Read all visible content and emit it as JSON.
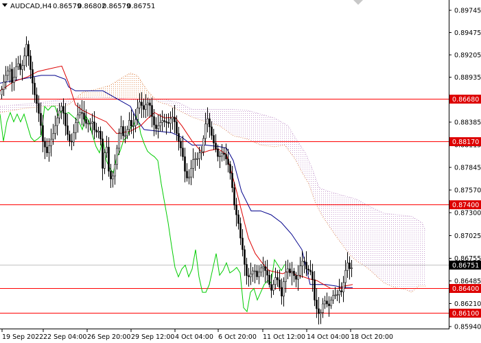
{
  "header": {
    "symbol": "AUDCAD,H4",
    "open": "0.86579",
    "high": "0.86802",
    "low": "0.86579",
    "close": "0.86751"
  },
  "colors": {
    "level_line": "#ff0000",
    "level_box": "#dd0000",
    "tenkan": "#dd0000",
    "kijun": "#00008b",
    "chikou": "#00cc00",
    "span_a_cloud": "#e0905a",
    "span_b_cloud": "#c8a0d0",
    "candle": "#000000",
    "current_price_line": "#c0c0c0",
    "current_price_box": "#000000"
  },
  "chart_data": {
    "type": "candlestick",
    "title": "AUDCAD,H4",
    "indicators": [
      "Ichimoku Kinko Hyo"
    ],
    "ylim": [
      0.8594,
      0.9004
    ],
    "y_ticks": [
      "0.89745",
      "0.89475",
      "0.89205",
      "0.88935",
      "0.88655",
      "0.88385",
      "0.88115",
      "0.87845",
      "0.87570",
      "0.87300",
      "0.87025",
      "0.86755",
      "0.86485",
      "0.86210",
      "0.85940"
    ],
    "x_ticks": [
      "19 Sep 2022",
      "22 Sep 04:00",
      "26 Sep 20:00",
      "29 Sep 12:00",
      "4 Oct 04:00",
      "6 Oct 20:00",
      "11 Oct 12:00",
      "14 Oct 04:00",
      "18 Oct 20:00"
    ],
    "levels": [
      {
        "label": "0.86680",
        "value": 0.8868
      },
      {
        "label": "0.88170",
        "value": 0.8817
      },
      {
        "label": "0.87400",
        "value": 0.874
      },
      {
        "label": "0.86400",
        "value": 0.864
      },
      {
        "label": "0.86100",
        "value": 0.861
      }
    ],
    "current_price": {
      "label": "0.86751",
      "value": 0.86751
    },
    "price_path": [
      [
        0,
        0.8895
      ],
      [
        6,
        0.8915
      ],
      [
        10,
        0.8925
      ],
      [
        14,
        0.8928
      ],
      [
        18,
        0.8905
      ],
      [
        22,
        0.893
      ],
      [
        26,
        0.8935
      ],
      [
        30,
        0.8925
      ],
      [
        34,
        0.894
      ],
      [
        38,
        0.896
      ],
      [
        42,
        0.894
      ],
      [
        46,
        0.8915
      ],
      [
        50,
        0.8895
      ],
      [
        54,
        0.888
      ],
      [
        58,
        0.8862
      ],
      [
        62,
        0.8835
      ],
      [
        68,
        0.882
      ],
      [
        73,
        0.8835
      ],
      [
        77,
        0.8845
      ],
      [
        82,
        0.8862
      ],
      [
        86,
        0.8874
      ],
      [
        90,
        0.8882
      ],
      [
        95,
        0.8855
      ],
      [
        99,
        0.884
      ],
      [
        103,
        0.883
      ],
      [
        108,
        0.885
      ],
      [
        112,
        0.8868
      ],
      [
        118,
        0.8874
      ],
      [
        124,
        0.8858
      ],
      [
        130,
        0.8858
      ],
      [
        134,
        0.886
      ],
      [
        138,
        0.8846
      ],
      [
        143,
        0.8848
      ],
      [
        146,
        0.8838
      ],
      [
        149,
        0.88
      ],
      [
        152,
        0.882
      ],
      [
        154,
        0.884
      ],
      [
        157,
        0.8802
      ],
      [
        160,
        0.8785
      ],
      [
        164,
        0.879
      ],
      [
        168,
        0.881
      ],
      [
        172,
        0.8842
      ],
      [
        176,
        0.8854
      ],
      [
        180,
        0.8838
      ],
      [
        184,
        0.8846
      ],
      [
        188,
        0.8862
      ],
      [
        192,
        0.8852
      ],
      [
        196,
        0.8858
      ],
      [
        200,
        0.8878
      ],
      [
        204,
        0.8888
      ],
      [
        208,
        0.8874
      ],
      [
        212,
        0.8882
      ],
      [
        217,
        0.8886
      ],
      [
        222,
        0.8862
      ],
      [
        226,
        0.885
      ],
      [
        230,
        0.8855
      ],
      [
        235,
        0.8862
      ],
      [
        240,
        0.886
      ],
      [
        245,
        0.8858
      ],
      [
        250,
        0.8868
      ],
      [
        254,
        0.886
      ],
      [
        258,
        0.884
      ],
      [
        262,
        0.883
      ],
      [
        266,
        0.8815
      ],
      [
        270,
        0.879
      ],
      [
        274,
        0.8785
      ],
      [
        278,
        0.88
      ],
      [
        282,
        0.8815
      ],
      [
        286,
        0.881
      ],
      [
        290,
        0.882
      ],
      [
        294,
        0.8822
      ],
      [
        298,
        0.8855
      ],
      [
        302,
        0.8864
      ],
      [
        306,
        0.885
      ],
      [
        310,
        0.8835
      ],
      [
        314,
        0.8825
      ],
      [
        318,
        0.8812
      ],
      [
        322,
        0.882
      ],
      [
        326,
        0.8818
      ],
      [
        330,
        0.881
      ],
      [
        334,
        0.88
      ],
      [
        338,
        0.8775
      ],
      [
        342,
        0.8745
      ],
      [
        346,
        0.8735
      ],
      [
        350,
        0.871
      ],
      [
        354,
        0.869
      ],
      [
        358,
        0.8662
      ],
      [
        362,
        0.866
      ],
      [
        366,
        0.8665
      ],
      [
        370,
        0.867
      ],
      [
        374,
        0.866
      ],
      [
        378,
        0.8668
      ],
      [
        382,
        0.8675
      ],
      [
        386,
        0.8668
      ],
      [
        390,
        0.866
      ],
      [
        394,
        0.864
      ],
      [
        398,
        0.865
      ],
      [
        402,
        0.8662
      ],
      [
        406,
        0.865
      ],
      [
        410,
        0.8635
      ],
      [
        414,
        0.866
      ],
      [
        418,
        0.8672
      ],
      [
        422,
        0.8665
      ],
      [
        426,
        0.8668
      ],
      [
        430,
        0.8655
      ],
      [
        434,
        0.8662
      ],
      [
        438,
        0.8678
      ],
      [
        442,
        0.8682
      ],
      [
        446,
        0.867
      ],
      [
        450,
        0.8668
      ],
      [
        454,
        0.8665
      ],
      [
        458,
        0.863
      ],
      [
        462,
        0.8615
      ],
      [
        466,
        0.861
      ],
      [
        470,
        0.8625
      ],
      [
        474,
        0.863
      ],
      [
        478,
        0.862
      ],
      [
        482,
        0.863
      ],
      [
        486,
        0.8638
      ],
      [
        490,
        0.8635
      ],
      [
        494,
        0.8642
      ],
      [
        498,
        0.864
      ],
      [
        502,
        0.8665
      ],
      [
        506,
        0.8678
      ],
      [
        510,
        0.8668
      ],
      [
        514,
        0.8675
      ]
    ],
    "tenkan_path": [
      [
        0,
        0.89
      ],
      [
        20,
        0.8912
      ],
      [
        40,
        0.8918
      ],
      [
        55,
        0.8925
      ],
      [
        70,
        0.8928
      ],
      [
        90,
        0.8932
      ],
      [
        100,
        0.891
      ],
      [
        110,
        0.8882
      ],
      [
        120,
        0.8875
      ],
      [
        140,
        0.8866
      ],
      [
        155,
        0.886
      ],
      [
        170,
        0.8845
      ],
      [
        190,
        0.8848
      ],
      [
        205,
        0.8855
      ],
      [
        215,
        0.8864
      ],
      [
        225,
        0.8872
      ],
      [
        240,
        0.8865
      ],
      [
        255,
        0.8866
      ],
      [
        265,
        0.8855
      ],
      [
        280,
        0.8835
      ],
      [
        295,
        0.882
      ],
      [
        305,
        0.8823
      ],
      [
        318,
        0.8825
      ],
      [
        330,
        0.8818
      ],
      [
        342,
        0.878
      ],
      [
        352,
        0.8745
      ],
      [
        362,
        0.871
      ],
      [
        372,
        0.869
      ],
      [
        382,
        0.8678
      ],
      [
        392,
        0.8668
      ],
      [
        402,
        0.8666
      ],
      [
        412,
        0.8664
      ],
      [
        422,
        0.8668
      ],
      [
        432,
        0.8662
      ],
      [
        442,
        0.866
      ],
      [
        452,
        0.8657
      ],
      [
        462,
        0.8655
      ],
      [
        472,
        0.865
      ],
      [
        482,
        0.8645
      ],
      [
        492,
        0.8645
      ],
      [
        502,
        0.8648
      ],
      [
        514,
        0.865
      ]
    ],
    "kijun_path": [
      [
        0,
        0.891
      ],
      [
        30,
        0.8915
      ],
      [
        60,
        0.892
      ],
      [
        80,
        0.892
      ],
      [
        95,
        0.8915
      ],
      [
        100,
        0.8905
      ],
      [
        110,
        0.89
      ],
      [
        150,
        0.89
      ],
      [
        170,
        0.889
      ],
      [
        190,
        0.888
      ],
      [
        200,
        0.8862
      ],
      [
        210,
        0.885
      ],
      [
        230,
        0.8848
      ],
      [
        250,
        0.8846
      ],
      [
        265,
        0.884
      ],
      [
        280,
        0.883
      ],
      [
        300,
        0.883
      ],
      [
        320,
        0.8828
      ],
      [
        330,
        0.8826
      ],
      [
        340,
        0.881
      ],
      [
        352,
        0.877
      ],
      [
        366,
        0.8745
      ],
      [
        380,
        0.8745
      ],
      [
        395,
        0.874
      ],
      [
        410,
        0.873
      ],
      [
        425,
        0.8715
      ],
      [
        440,
        0.8695
      ],
      [
        452,
        0.865
      ],
      [
        462,
        0.865
      ],
      [
        475,
        0.865
      ],
      [
        490,
        0.8648
      ],
      [
        500,
        0.8646
      ],
      [
        514,
        0.8646
      ]
    ],
    "chikou_path": [
      [
        0,
        0.887
      ],
      [
        5,
        0.8835
      ],
      [
        10,
        0.886
      ],
      [
        15,
        0.8872
      ],
      [
        20,
        0.886
      ],
      [
        25,
        0.887
      ],
      [
        30,
        0.886
      ],
      [
        35,
        0.887
      ],
      [
        40,
        0.8855
      ],
      [
        45,
        0.884
      ],
      [
        50,
        0.8835
      ],
      [
        55,
        0.8838
      ],
      [
        60,
        0.8842
      ],
      [
        65,
        0.888
      ],
      [
        70,
        0.8875
      ],
      [
        75,
        0.888
      ],
      [
        80,
        0.888
      ],
      [
        85,
        0.8868
      ],
      [
        90,
        0.8875
      ],
      [
        95,
        0.887
      ],
      [
        100,
        0.8872
      ],
      [
        105,
        0.8868
      ],
      [
        110,
        0.8864
      ],
      [
        115,
        0.886
      ],
      [
        120,
        0.885
      ],
      [
        125,
        0.8868
      ],
      [
        130,
        0.886
      ],
      [
        135,
        0.8842
      ],
      [
        140,
        0.8828
      ],
      [
        145,
        0.882
      ],
      [
        150,
        0.8838
      ],
      [
        155,
        0.881
      ],
      [
        160,
        0.88
      ],
      [
        165,
        0.8794
      ],
      [
        170,
        0.8814
      ],
      [
        175,
        0.8822
      ],
      [
        180,
        0.8836
      ],
      [
        185,
        0.884
      ],
      [
        190,
        0.8852
      ],
      [
        195,
        0.8856
      ],
      [
        200,
        0.887
      ],
      [
        205,
        0.8845
      ],
      [
        210,
        0.8832
      ],
      [
        215,
        0.8822
      ],
      [
        220,
        0.8818
      ],
      [
        225,
        0.8815
      ],
      [
        230,
        0.881
      ],
      [
        235,
        0.878
      ],
      [
        240,
        0.8755
      ],
      [
        245,
        0.873
      ],
      [
        250,
        0.87
      ],
      [
        255,
        0.8672
      ],
      [
        260,
        0.866
      ],
      [
        265,
        0.867
      ],
      [
        270,
        0.8675
      ],
      [
        275,
        0.866
      ],
      [
        280,
        0.867
      ],
      [
        285,
        0.8695
      ],
      [
        290,
        0.866
      ],
      [
        295,
        0.864
      ],
      [
        300,
        0.864
      ],
      [
        305,
        0.865
      ],
      [
        310,
        0.867
      ],
      [
        315,
        0.869
      ],
      [
        320,
        0.8662
      ],
      [
        325,
        0.8668
      ],
      [
        330,
        0.8678
      ],
      [
        335,
        0.8665
      ],
      [
        340,
        0.8668
      ],
      [
        345,
        0.8672
      ],
      [
        350,
        0.8665
      ],
      [
        355,
        0.862
      ],
      [
        360,
        0.8615
      ],
      [
        365,
        0.864
      ],
      [
        370,
        0.8645
      ],
      [
        375,
        0.863
      ],
      [
        380,
        0.864
      ],
      [
        385,
        0.865
      ],
      [
        390,
        0.8655
      ],
      [
        395,
        0.8652
      ],
      [
        400,
        0.8682
      ],
      [
        405,
        0.8675
      ],
      [
        410,
        0.8668
      ],
      [
        415,
        0.8676
      ]
    ],
    "span_a_path": [
      [
        0,
        0.8872
      ],
      [
        40,
        0.8878
      ],
      [
        70,
        0.888
      ],
      [
        100,
        0.8882
      ],
      [
        120,
        0.8898
      ],
      [
        140,
        0.8902
      ],
      [
        160,
        0.8907
      ],
      [
        180,
        0.8918
      ],
      [
        190,
        0.8923
      ],
      [
        200,
        0.892
      ],
      [
        215,
        0.89
      ],
      [
        230,
        0.8886
      ],
      [
        245,
        0.8882
      ],
      [
        260,
        0.8875
      ],
      [
        280,
        0.8866
      ],
      [
        300,
        0.886
      ],
      [
        320,
        0.8855
      ],
      [
        340,
        0.8842
      ],
      [
        360,
        0.8838
      ],
      [
        380,
        0.883
      ],
      [
        400,
        0.8828
      ],
      [
        415,
        0.883
      ],
      [
        430,
        0.8812
      ],
      [
        440,
        0.8795
      ],
      [
        450,
        0.878
      ],
      [
        460,
        0.8755
      ],
      [
        470,
        0.8738
      ],
      [
        480,
        0.8725
      ],
      [
        490,
        0.8712
      ],
      [
        500,
        0.87
      ],
      [
        510,
        0.8688
      ],
      [
        520,
        0.868
      ],
      [
        530,
        0.8675
      ],
      [
        540,
        0.8668
      ],
      [
        550,
        0.866
      ],
      [
        560,
        0.8652
      ],
      [
        570,
        0.8648
      ],
      [
        580,
        0.8645
      ],
      [
        590,
        0.8644
      ],
      [
        600,
        0.864
      ],
      [
        610,
        0.8648
      ],
      [
        620,
        0.8648
      ]
    ],
    "span_b_path": [
      [
        0,
        0.888
      ],
      [
        60,
        0.8885
      ],
      [
        100,
        0.889
      ],
      [
        140,
        0.8892
      ],
      [
        180,
        0.889
      ],
      [
        200,
        0.8888
      ],
      [
        220,
        0.8888
      ],
      [
        240,
        0.8889
      ],
      [
        260,
        0.8885
      ],
      [
        280,
        0.8876
      ],
      [
        300,
        0.8876
      ],
      [
        320,
        0.8876
      ],
      [
        340,
        0.8876
      ],
      [
        360,
        0.8875
      ],
      [
        380,
        0.887
      ],
      [
        400,
        0.8865
      ],
      [
        420,
        0.8855
      ],
      [
        430,
        0.884
      ],
      [
        445,
        0.882
      ],
      [
        455,
        0.88
      ],
      [
        465,
        0.8775
      ],
      [
        480,
        0.877
      ],
      [
        500,
        0.8765
      ],
      [
        520,
        0.876
      ],
      [
        540,
        0.875
      ],
      [
        560,
        0.8742
      ],
      [
        580,
        0.874
      ],
      [
        600,
        0.8738
      ],
      [
        615,
        0.873
      ],
      [
        620,
        0.872
      ]
    ]
  }
}
